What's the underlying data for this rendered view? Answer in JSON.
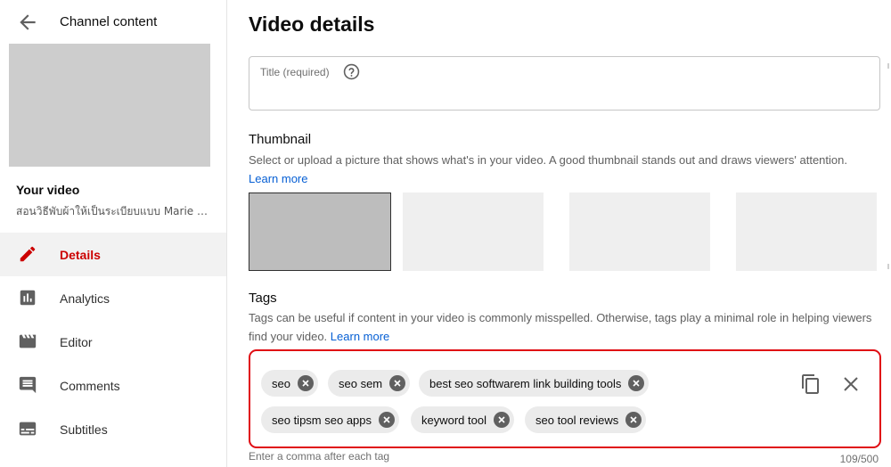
{
  "sidebar": {
    "title": "Channel content",
    "your_video_label": "Your video",
    "video_name": "สอนวิธีพับผ้าให้เป็นระเบียบแบบ Marie …",
    "nav": [
      {
        "label": "Details",
        "icon": "pencil-icon",
        "active": true
      },
      {
        "label": "Analytics",
        "icon": "analytics-icon",
        "active": false
      },
      {
        "label": "Editor",
        "icon": "clapperboard-icon",
        "active": false
      },
      {
        "label": "Comments",
        "icon": "comment-icon",
        "active": false
      },
      {
        "label": "Subtitles",
        "icon": "subtitles-icon",
        "active": false
      }
    ]
  },
  "main": {
    "page_title": "Video details",
    "title_field": {
      "label": "Title (required)",
      "value": ""
    },
    "thumbnail": {
      "title": "Thumbnail",
      "description": "Select or upload a picture that shows what's in your video. A good thumbnail stands out and draws viewers' attention.",
      "learn_more": "Learn more"
    },
    "tags": {
      "title": "Tags",
      "description": "Tags can be useful if content in your video is commonly misspelled. Otherwise, tags play a minimal role in helping viewers find your video.",
      "learn_more": "Learn more",
      "chips": [
        "seo",
        "seo sem",
        "best seo softwarem link building tools",
        "seo tipsm seo apps",
        "keyword tool",
        "seo tool reviews"
      ],
      "hint": "Enter a comma after each tag",
      "counter": "109/500"
    }
  },
  "colors": {
    "accent_red": "#cc0000",
    "highlight_border": "#e00d14",
    "link_blue": "#065fd4"
  }
}
